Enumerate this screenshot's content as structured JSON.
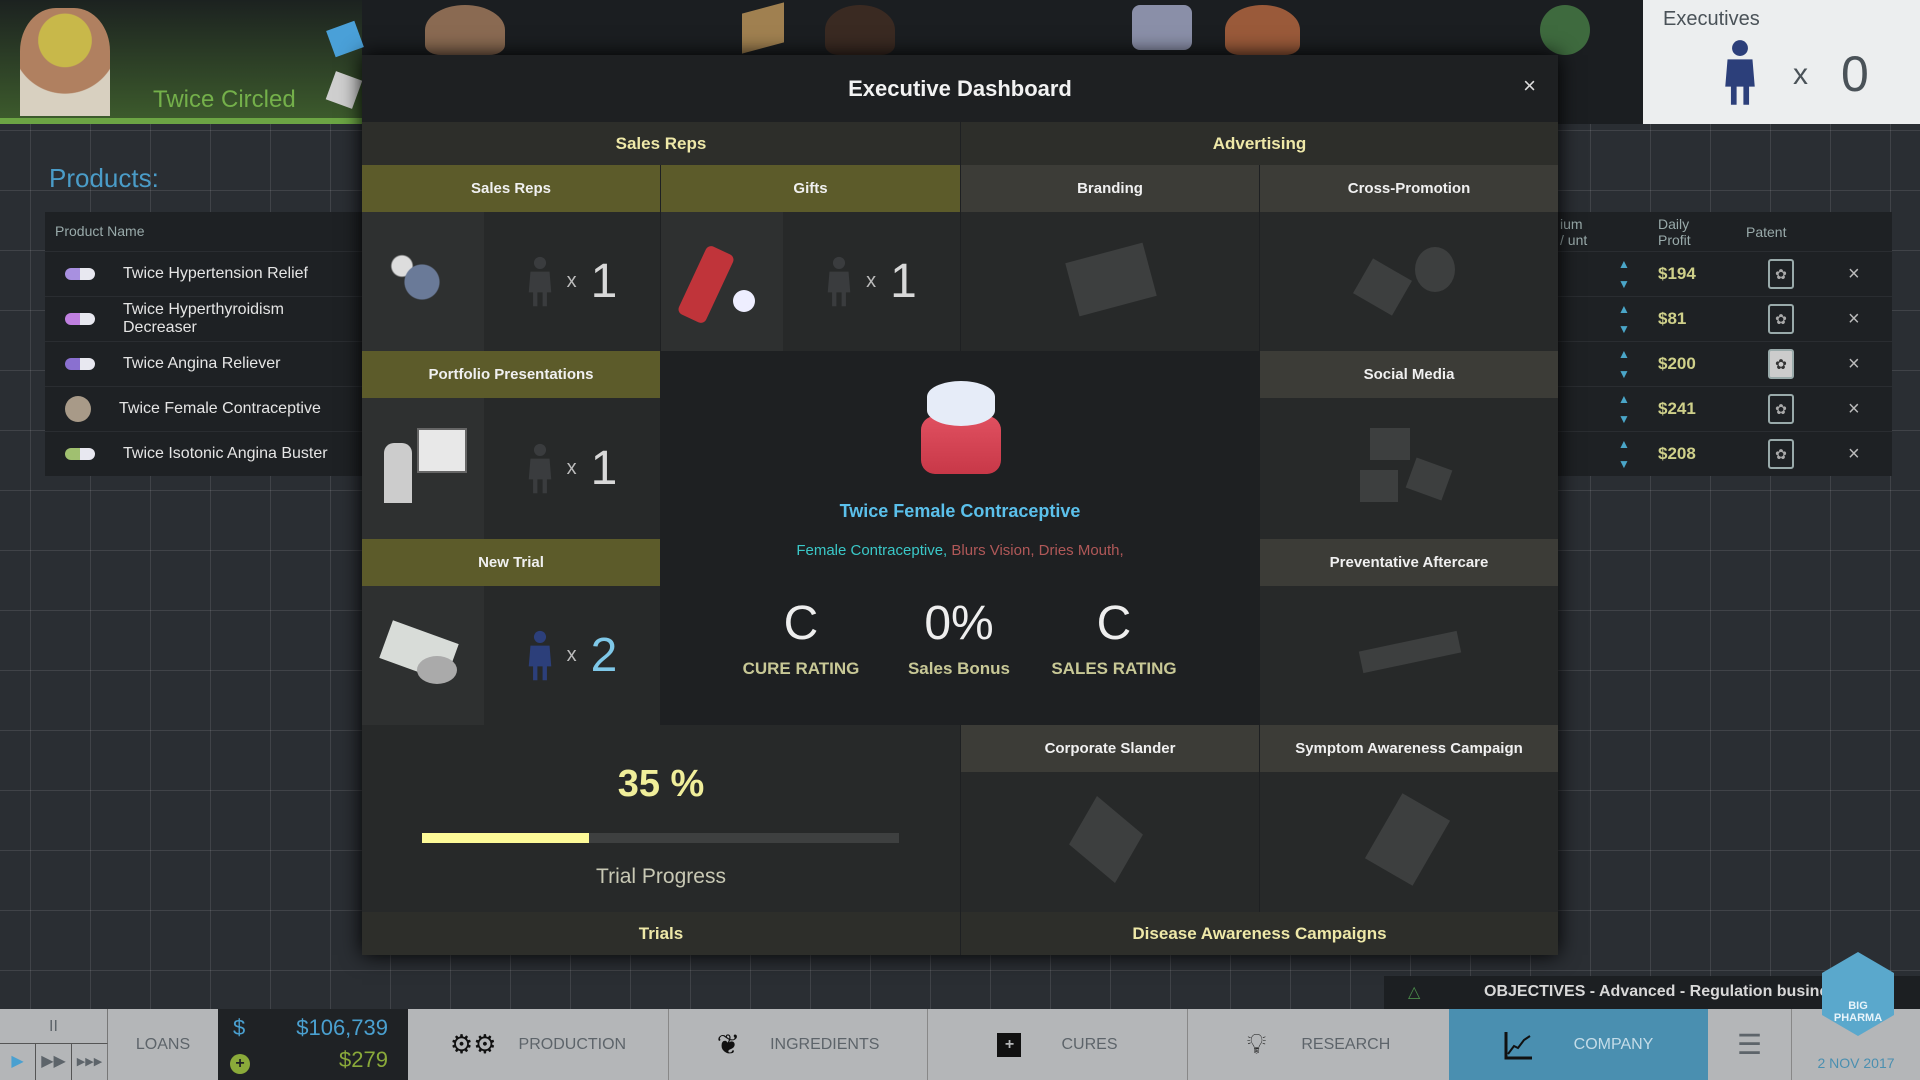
{
  "company": {
    "name": "Twice Circled"
  },
  "executives": {
    "title": "Executives",
    "multiplier": "x",
    "count": "0"
  },
  "products": {
    "title": "Products:",
    "columns": [
      "Product Name",
      "ium / unt",
      "Daily Profit",
      "Patent"
    ],
    "rows": [
      {
        "name": "Twice Hypertension Relief",
        "profit": "$194",
        "patent_active": false
      },
      {
        "name": "Twice Hyperthyroidism Decreaser",
        "profit": "$81",
        "patent_active": false
      },
      {
        "name": "Twice Angina Reliever",
        "profit": "$200",
        "patent_active": true
      },
      {
        "name": "Twice Female Contraceptive",
        "profit": "$241",
        "patent_active": false
      },
      {
        "name": "Twice Isotonic Angina Buster",
        "profit": "$208",
        "patent_active": false
      }
    ]
  },
  "modal": {
    "title": "Executive Dashboard",
    "close": "×",
    "sections": {
      "sales_reps": "Sales Reps",
      "advertising": "Advertising",
      "trials": "Trials",
      "disease": "Disease Awareness Campaigns"
    },
    "slots": {
      "sales_reps": {
        "label": "Sales Reps",
        "count": "1"
      },
      "gifts": {
        "label": "Gifts",
        "count": "1"
      },
      "portfolio": {
        "label": "Portfolio Presentations",
        "count": "1"
      },
      "new_trial": {
        "label": "New Trial",
        "count": "2"
      },
      "branding": {
        "label": "Branding"
      },
      "cross_promotion": {
        "label": "Cross-Promotion"
      },
      "social_media": {
        "label": "Social Media"
      },
      "preventative": {
        "label": "Preventative Aftercare"
      },
      "slander": {
        "label": "Corporate Slander"
      },
      "symptom": {
        "label": "Symptom Awareness Campaign"
      }
    },
    "multiplier": "x",
    "product": {
      "name": "Twice Female Contraceptive",
      "cure": "Female Contraceptive,",
      "side_effects": [
        "Blurs Vision,",
        "Dries Mouth,"
      ],
      "cure_rating": "C",
      "cure_rating_label": "CURE RATING",
      "sales_bonus": "0%",
      "sales_bonus_label": "Sales Bonus",
      "sales_rating": "C",
      "sales_rating_label": "SALES RATING"
    },
    "trial": {
      "percent_text": "35 %",
      "progress": 0.35,
      "label": "Trial Progress"
    }
  },
  "objectives": {
    "text": "OBJECTIVES - Advanced - Regulation business"
  },
  "bottom": {
    "pause": "II",
    "loans": "LOANS",
    "money": "$106,739",
    "income": "$279",
    "currency": "$",
    "tabs": [
      {
        "label": "PRODUCTION",
        "icon": "gears-icon"
      },
      {
        "label": "INGREDIENTS",
        "icon": "leaf-icon"
      },
      {
        "label": "CURES",
        "icon": "medical-cross-icon"
      },
      {
        "label": "RESEARCH",
        "icon": "lightbulb-icon"
      },
      {
        "label": "COMPANY",
        "icon": "chart-icon",
        "active": true
      }
    ],
    "date": "2 NOV 2017",
    "logo": "BIG PHARMA"
  },
  "colors": {
    "accent": "#4a8fb0",
    "olive": "#5c5b2a",
    "green": "#6ca544",
    "profit": "#cfd08a"
  }
}
